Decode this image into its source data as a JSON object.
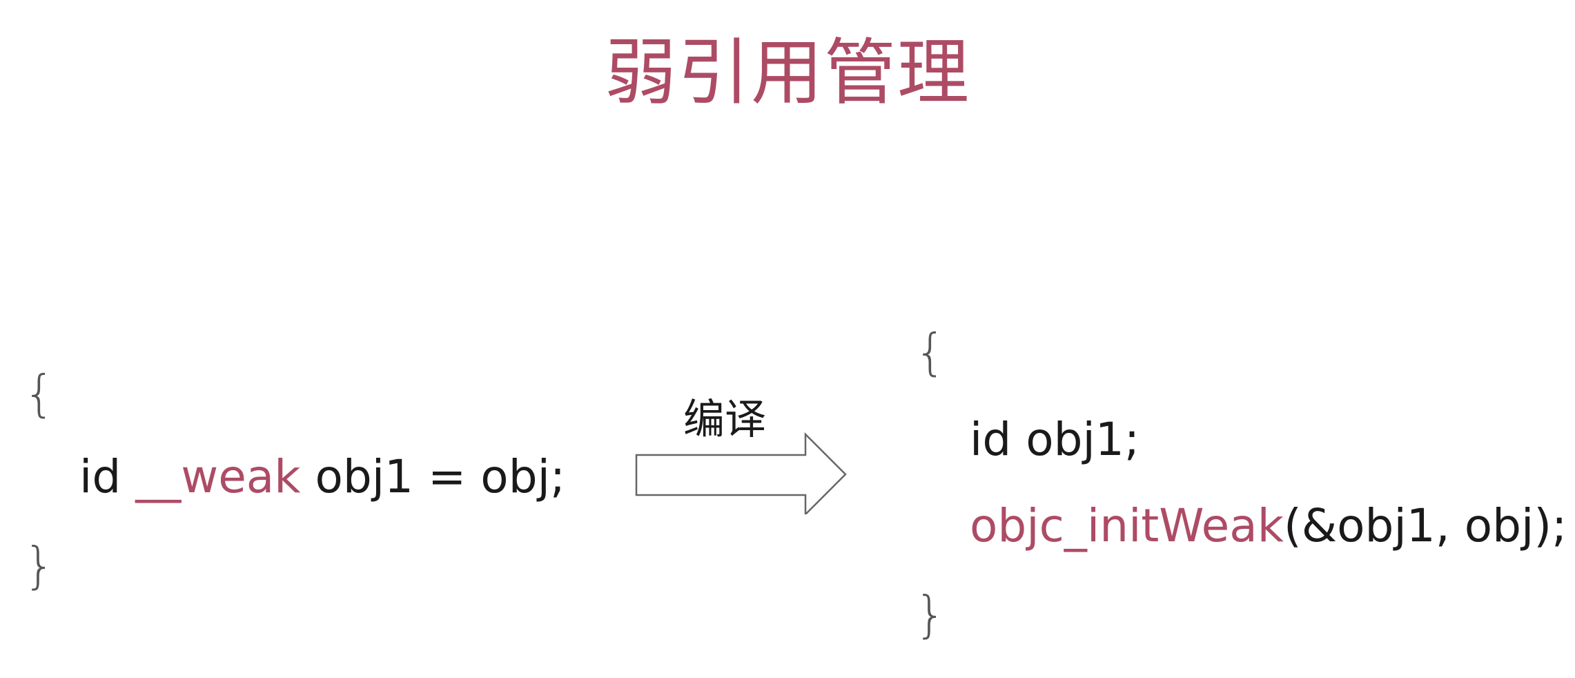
{
  "title": "弱引用管理",
  "left_code": {
    "open_brace": "{",
    "line_pre": "id ",
    "line_keyword": "__weak",
    "line_post": " obj1 = obj;",
    "close_brace": "}"
  },
  "arrow_label": "编译",
  "right_code": {
    "open_brace": "{",
    "line1": "id obj1;",
    "line2_keyword": "objc_initWeak",
    "line2_post": "(&obj1, obj);",
    "close_brace": "}"
  },
  "colors": {
    "accent": "#ad4b65",
    "text": "#1a1a1a",
    "brace": "#555555",
    "arrow_stroke": "#666666"
  }
}
